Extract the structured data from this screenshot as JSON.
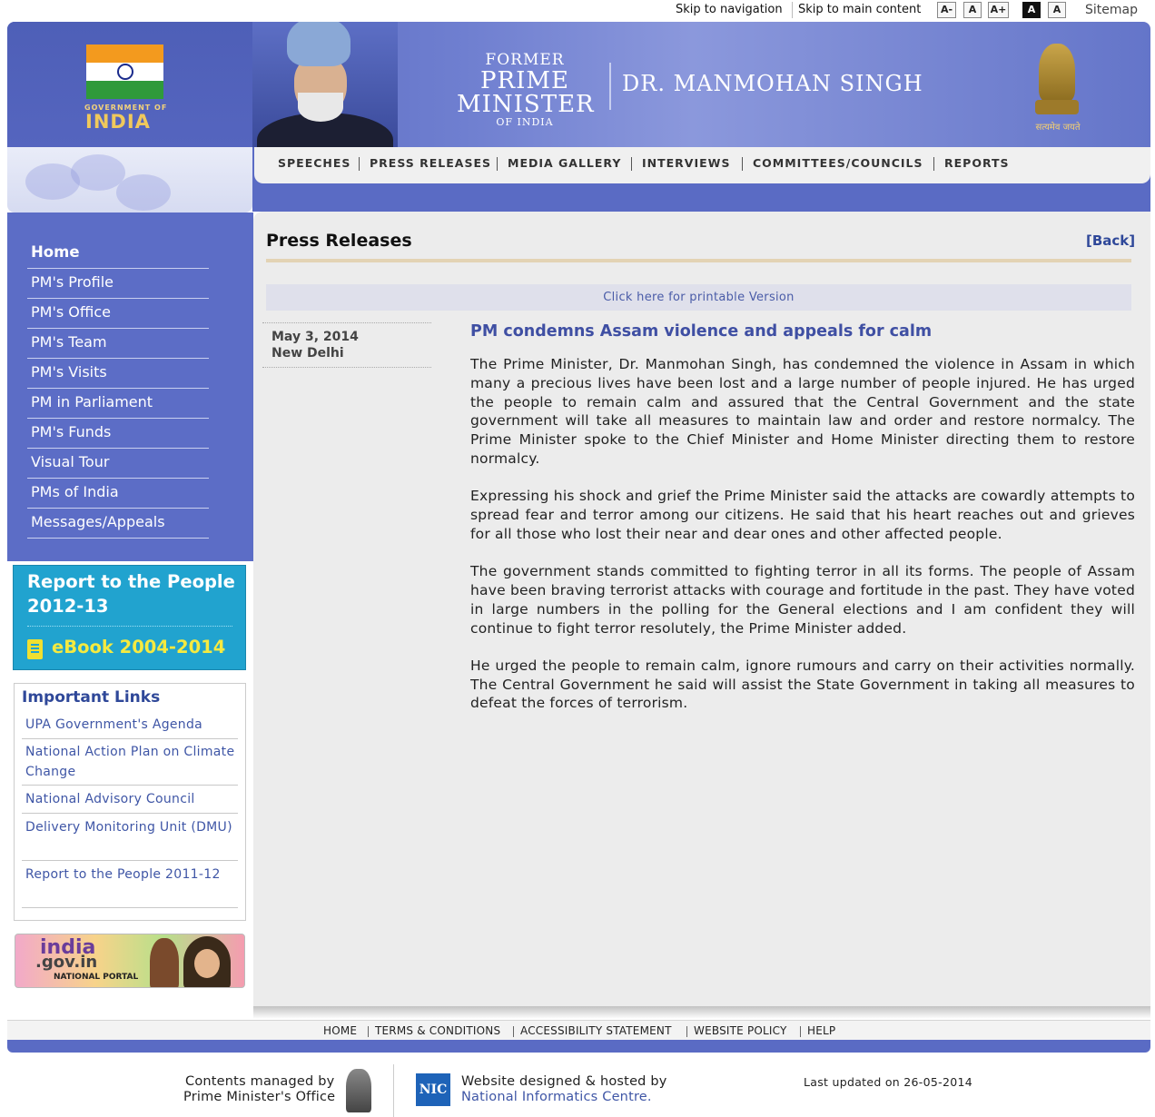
{
  "topbar": {
    "skip_nav": "Skip to navigation",
    "skip_main": "Skip to main content",
    "font_decrease": "A-",
    "font_normal": "A",
    "font_increase": "A+",
    "contrast_high": "A",
    "contrast_normal": "A",
    "sitemap": "Sitemap"
  },
  "header": {
    "goi_small": "GOVERNMENT OF",
    "goi_big": "INDIA",
    "title_former": "FORMER",
    "title_prime": "PRIME",
    "title_minister": "MINISTER",
    "title_of_india": "OF INDIA",
    "name": "DR. MANMOHAN SINGH",
    "emblem_motto": "सत्यमेव जयते",
    "colors": {
      "banner": "#5a6bc4",
      "accent_gold": "#f0c95c"
    }
  },
  "nav": {
    "items": [
      "SPEECHES",
      "PRESS RELEASES",
      "MEDIA GALLERY",
      "INTERVIEWS",
      "COMMITTEES/COUNCILS",
      "REPORTS"
    ]
  },
  "sidebar": {
    "items": [
      "Home",
      "PM's Profile",
      "PM's Office",
      "PM's Team",
      "PM's Visits",
      "PM in Parliament",
      "PM's Funds",
      "Visual Tour",
      "PMs of India",
      "Messages/Appeals"
    ]
  },
  "report_box": {
    "title": "Report to the People 2012-13",
    "ebook": "eBook 2004-2014",
    "icon": "ebook-icon"
  },
  "important_links": {
    "title": "Important Links",
    "items": [
      "UPA Government's Agenda",
      "National Action Plan on Climate Change",
      "National Advisory Council",
      "Delivery Monitoring Unit (DMU)",
      "Report to the People 2011-12"
    ]
  },
  "portal": {
    "line1": "india",
    "line2": ".gov.in",
    "line3": "NATIONAL PORTAL"
  },
  "main": {
    "page_title": "Press Releases",
    "back": "[Back]",
    "print_link": "Click here for printable Version",
    "date": "May 3, 2014",
    "place": "New Delhi",
    "headline": "PM condemns Assam violence and appeals for calm",
    "paragraphs": [
      "The Prime Minister, Dr. Manmohan Singh, has condemned the violence in Assam in which many a precious lives have been lost and a large number of people injured. He has urged the people to remain calm and assured that the Central Government and the state government will take all measures to maintain law and order and restore normalcy. The Prime Minister spoke to the Chief Minister and Home Minister directing them to restore normalcy.",
      "Expressing his shock and grief the Prime Minister said the attacks are cowardly attempts to spread fear and terror among our citizens. He said that his heart reaches out and grieves for all those who lost their near and dear ones and other affected people.",
      "The government stands committed to fighting terror in all its forms. The people of Assam have been braving terrorist attacks with courage and fortitude in the past. They have voted in large numbers in the polling for the General elections and I am confident they will continue to fight terror resolutely, the Prime Minister added.",
      "He urged the people to remain calm, ignore rumours and carry on their activities normally. The Central Government he said will assist the State Government in taking all measures to defeat the forces of terrorism."
    ]
  },
  "footer": {
    "links": [
      "HOME",
      "TERMS & CONDITIONS",
      "ACCESSIBILITY STATEMENT",
      "WEBSITE POLICY",
      "HELP"
    ],
    "contents_line1": "Contents managed by",
    "contents_line2": "Prime Minister's Office",
    "nic_logo": "NIC",
    "designed_line1": "Website designed & hosted by",
    "designed_line2": "National Informatics Centre.",
    "last_updated": "Last updated on 26-05-2014"
  }
}
